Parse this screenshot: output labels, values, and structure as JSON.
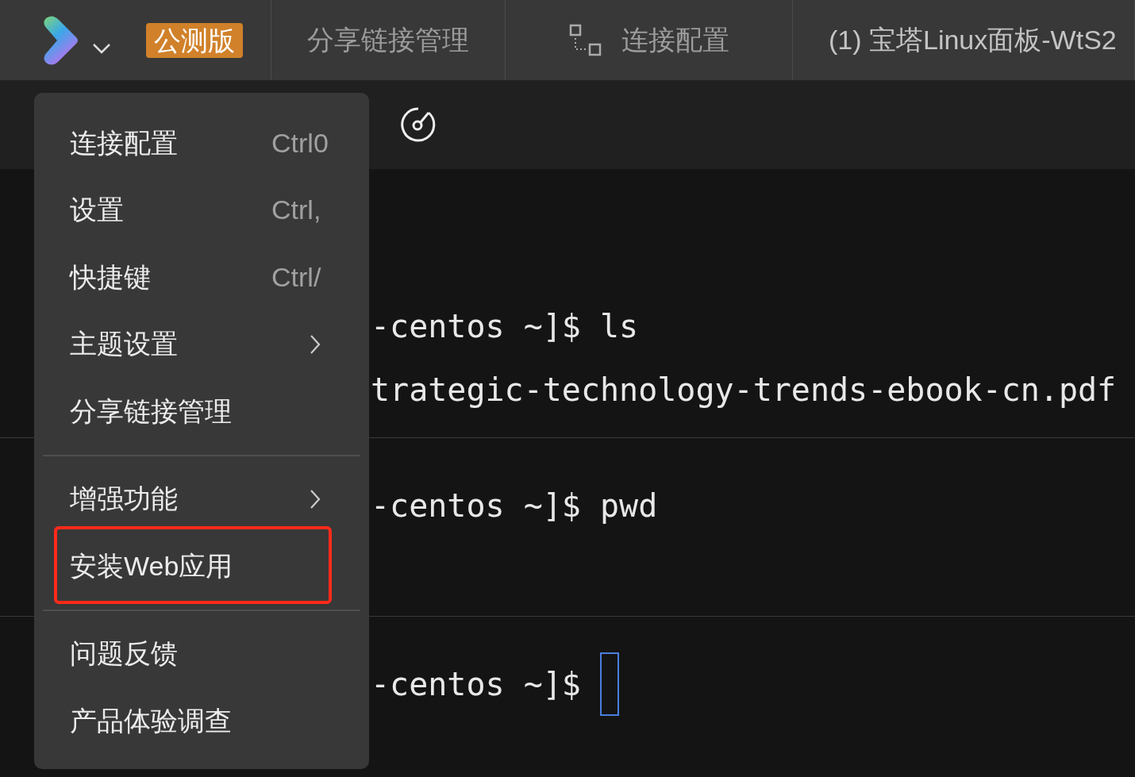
{
  "top_bar": {
    "badge": "公测版",
    "tabs": [
      {
        "label": "分享链接管理",
        "kind": "plain",
        "selected": false
      },
      {
        "label": "连接配置",
        "kind": "nodes",
        "selected": false
      },
      {
        "label": "(1) 宝塔Linux面板-WtS2",
        "kind": "plain",
        "selected": true
      }
    ]
  },
  "terminal": {
    "blocks": [
      {
        "lines": [
          "-centos ~]$ ls",
          "trategic-technology-trends-ebook-cn.pdf"
        ],
        "cursor": false
      },
      {
        "lines": [
          "-centos ~]$ pwd"
        ],
        "cursor": false
      },
      {
        "lines": [
          "-centos ~]$ "
        ],
        "cursor": true
      }
    ]
  },
  "menu": {
    "sections": [
      [
        {
          "label": "连接配置",
          "shortcut": "Ctrl0",
          "submenu": false,
          "highlighted": false
        },
        {
          "label": "设置",
          "shortcut": "Ctrl,",
          "submenu": false,
          "highlighted": false
        },
        {
          "label": "快捷键",
          "shortcut": "Ctrl/",
          "submenu": false,
          "highlighted": false
        },
        {
          "label": "主题设置",
          "submenu": true,
          "highlighted": false
        },
        {
          "label": "分享链接管理",
          "submenu": false,
          "highlighted": false
        }
      ],
      [
        {
          "label": "增强功能",
          "submenu": true,
          "highlighted": false
        },
        {
          "label": "安装Web应用",
          "submenu": false,
          "highlighted": true
        }
      ],
      [
        {
          "label": "问题反馈",
          "submenu": false,
          "highlighted": false
        },
        {
          "label": "产品体验调查",
          "submenu": false,
          "highlighted": false
        }
      ]
    ]
  }
}
